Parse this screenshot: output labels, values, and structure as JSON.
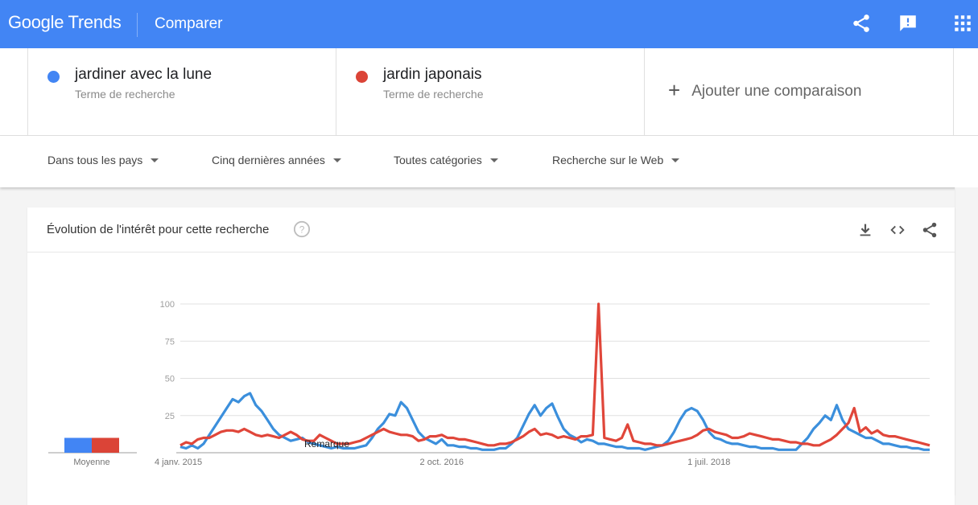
{
  "header": {
    "logo_text": "Google Trends",
    "page_title": "Comparer",
    "icons": [
      "share-icon",
      "feedback-icon",
      "apps-grid-icon"
    ]
  },
  "terms": [
    {
      "name": "jardiner avec la lune",
      "type": "Terme de recherche",
      "color": "#4285f4"
    },
    {
      "name": "jardin japonais",
      "type": "Terme de recherche",
      "color": "#db4437"
    }
  ],
  "add_comparison": {
    "icon": "plus-icon",
    "label": "Ajouter une comparaison"
  },
  "filters": [
    {
      "label": "Dans tous les pays"
    },
    {
      "label": "Cinq dernières années"
    },
    {
      "label": "Toutes catégories"
    },
    {
      "label": "Recherche sur le Web"
    }
  ],
  "card": {
    "title": "Évolution de l'intérêt pour cette recherche",
    "icons": [
      "help-icon",
      "download-icon",
      "embed-code-icon",
      "share-icon"
    ]
  },
  "chart_data": {
    "type": "line",
    "title": "Évolution de l'intérêt pour cette recherche",
    "xlabel": "",
    "ylabel": "",
    "ylim": [
      0,
      100
    ],
    "yticks": [
      25,
      50,
      75,
      100
    ],
    "grid": true,
    "x_tick_labels": [
      {
        "label": "4 janv. 2015",
        "index": 0
      },
      {
        "label": "2 oct. 2016",
        "index": 45
      },
      {
        "label": "1 juil. 2018",
        "index": 91
      }
    ],
    "x_points": 130,
    "x_interval": "2 weeks",
    "annotation": "Remarque",
    "average_label": "Moyenne",
    "averages": [
      {
        "name": "jardiner avec la lune",
        "value": 10
      },
      {
        "name": "jardin japonais",
        "value": 10
      }
    ],
    "series": [
      {
        "name": "jardiner avec la lune",
        "color": "#4285f4",
        "values": [
          4,
          3,
          5,
          3,
          6,
          12,
          18,
          24,
          30,
          36,
          34,
          38,
          40,
          32,
          28,
          22,
          16,
          12,
          10,
          8,
          9,
          10,
          7,
          6,
          5,
          4,
          3,
          4,
          3,
          3,
          3,
          4,
          5,
          10,
          16,
          20,
          26,
          25,
          34,
          30,
          22,
          14,
          10,
          8,
          6,
          9,
          5,
          5,
          4,
          4,
          3,
          3,
          2,
          2,
          2,
          3,
          3,
          6,
          10,
          18,
          26,
          32,
          25,
          30,
          33,
          24,
          16,
          12,
          10,
          7,
          9,
          8,
          6,
          6,
          5,
          4,
          4,
          3,
          3,
          3,
          2,
          3,
          4,
          5,
          8,
          14,
          22,
          28,
          30,
          28,
          22,
          14,
          10,
          9,
          7,
          6,
          6,
          5,
          4,
          4,
          3,
          3,
          3,
          2,
          2,
          2,
          2,
          6,
          10,
          16,
          20,
          25,
          22,
          32,
          22,
          16,
          14,
          12,
          10,
          10,
          8,
          6,
          6,
          5,
          4,
          4,
          3,
          3,
          2,
          2
        ]
      },
      {
        "name": "jardin japonais",
        "color": "#db4437",
        "values": [
          5,
          7,
          6,
          9,
          10,
          10,
          12,
          14,
          15,
          15,
          14,
          16,
          14,
          12,
          11,
          12,
          11,
          10,
          12,
          14,
          12,
          9,
          8,
          8,
          12,
          10,
          8,
          6,
          6,
          6,
          7,
          8,
          10,
          12,
          14,
          16,
          14,
          13,
          12,
          12,
          11,
          8,
          9,
          11,
          11,
          12,
          10,
          10,
          9,
          9,
          8,
          7,
          6,
          5,
          5,
          6,
          6,
          7,
          9,
          11,
          14,
          16,
          12,
          13,
          12,
          10,
          11,
          10,
          9,
          11,
          11,
          12,
          100,
          10,
          9,
          8,
          10,
          19,
          8,
          7,
          6,
          6,
          5,
          5,
          6,
          7,
          8,
          9,
          10,
          12,
          15,
          16,
          14,
          13,
          12,
          10,
          10,
          11,
          13,
          12,
          11,
          10,
          9,
          9,
          8,
          7,
          7,
          6,
          6,
          5,
          5,
          7,
          9,
          12,
          16,
          20,
          30,
          14,
          17,
          13,
          15,
          12,
          11,
          11,
          10,
          9,
          8,
          7,
          6,
          5
        ]
      }
    ]
  }
}
